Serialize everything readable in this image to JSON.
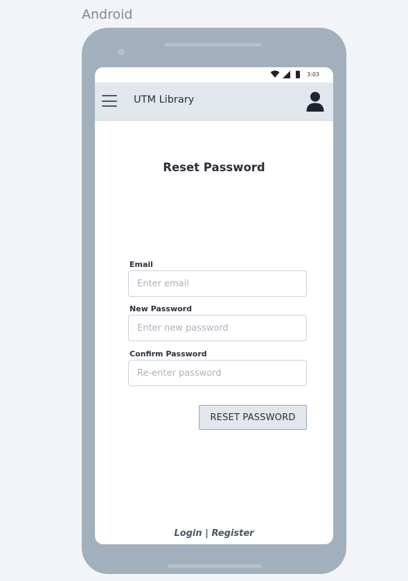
{
  "frame": {
    "label": "Android"
  },
  "status_bar": {
    "time": "3:03",
    "icons": [
      "wifi-icon",
      "signal-icon",
      "battery-icon"
    ]
  },
  "app_bar": {
    "title": "UTM Library",
    "menu_icon": "menu-icon",
    "profile_icon": "profile-icon"
  },
  "form": {
    "title": "Reset Password",
    "fields": [
      {
        "label": "Email",
        "placeholder": "Enter email",
        "value": ""
      },
      {
        "label": "New Password",
        "placeholder": "Enter new password",
        "value": ""
      },
      {
        "label": "Confirm Password",
        "placeholder": "Re-enter password",
        "value": ""
      }
    ],
    "submit_label": "RESET PASSWORD"
  },
  "footer": {
    "login_label": "Login",
    "separator": "|",
    "register_label": "Register"
  },
  "colors": {
    "background": "#f2f4f7",
    "phone_body": "#a2b0bd",
    "app_bar": "#e1e7ed",
    "button_fill": "#e1e7ed",
    "text_dark": "#2a2f38",
    "placeholder": "#a9b3bd"
  }
}
